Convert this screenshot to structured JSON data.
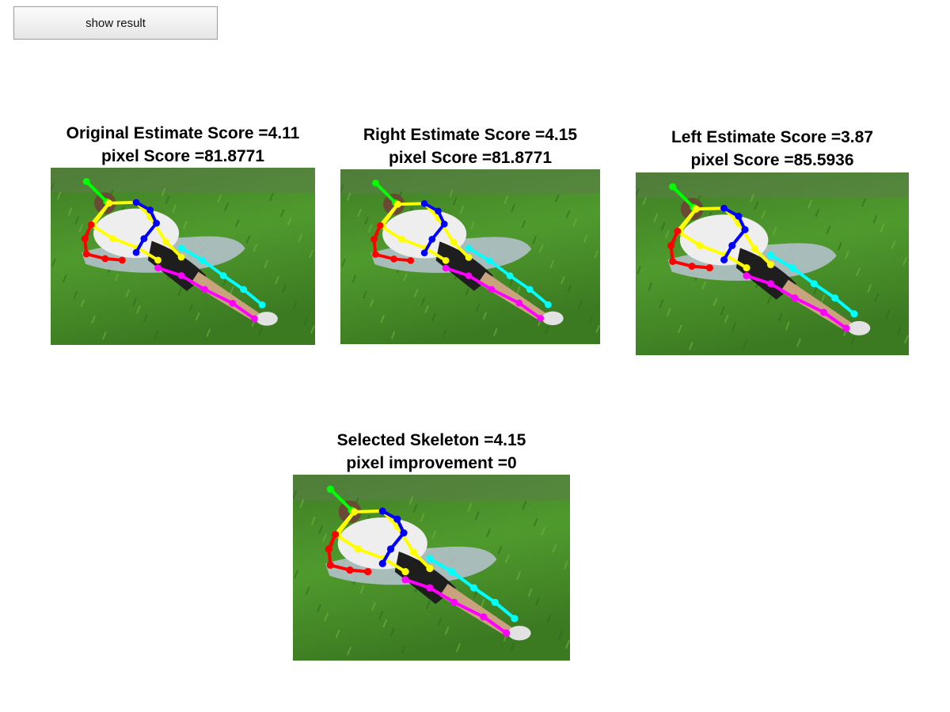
{
  "toolbar": {
    "show_result_label": "show result"
  },
  "panels": [
    {
      "line1": "Original Estimate Score =4.11",
      "line2": "pixel Score =81.8771"
    },
    {
      "line1": "Right Estimate Score =4.15",
      "line2": "pixel Score =81.8771"
    },
    {
      "line1": "Left Estimate Score =3.87",
      "line2": "pixel Score =85.5936"
    },
    {
      "line1": "Selected Skeleton =4.15",
      "line2": "pixel improvement =0"
    }
  ],
  "colors": {
    "head": "#00ff00",
    "torso": "#ffff00",
    "right_arm": "#0000ff",
    "left_arm": "#ff0000",
    "right_leg": "#00ffff",
    "left_leg": "#ff00ff"
  }
}
